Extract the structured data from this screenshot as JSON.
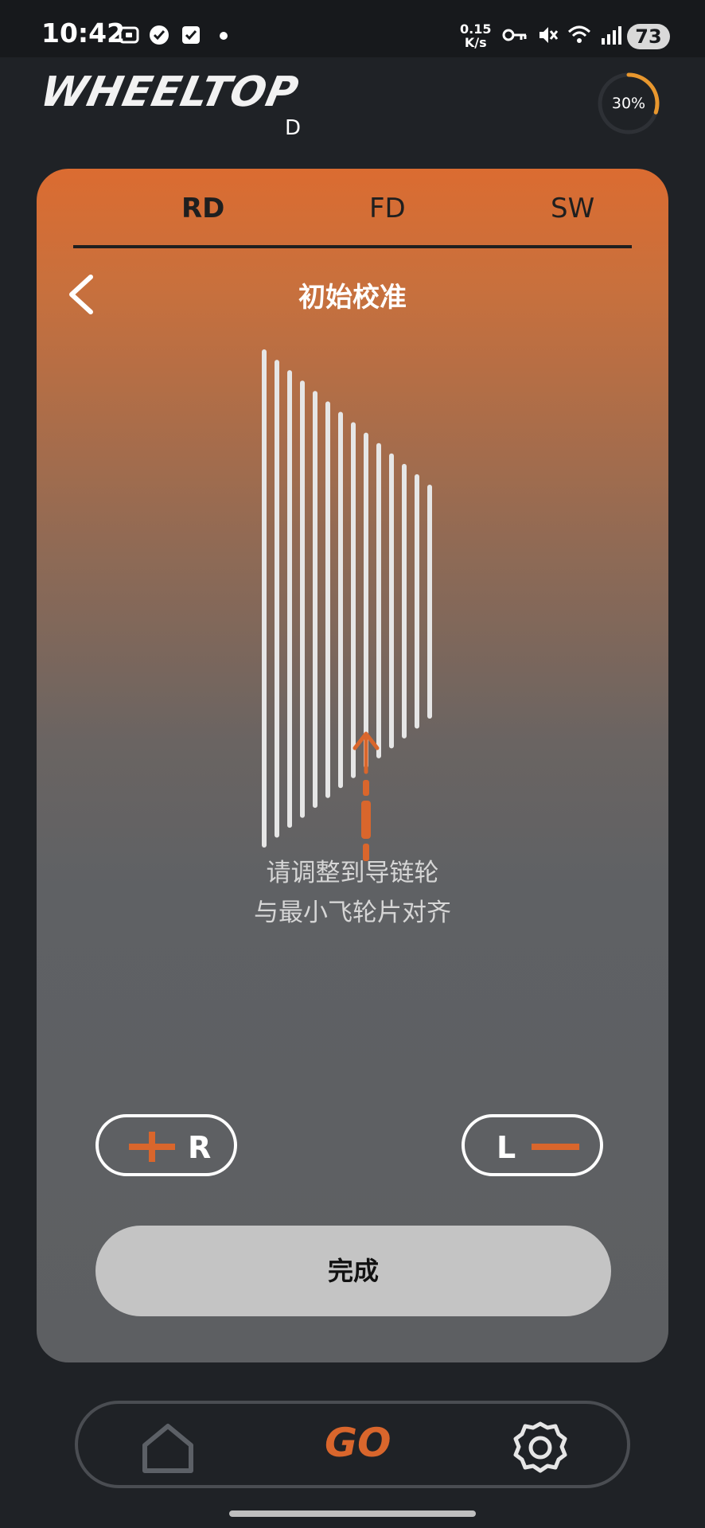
{
  "status_bar": {
    "time": "10:42",
    "net_speed_value": "0.15",
    "net_speed_unit": "K/s",
    "battery": "73"
  },
  "app": {
    "logo": "WHEELTOP",
    "logo_sub": "D",
    "progress": "30%",
    "progress_fraction": 0.3
  },
  "tabs": [
    {
      "label": "RD",
      "active": true
    },
    {
      "label": "FD",
      "active": false
    },
    {
      "label": "SW",
      "active": false
    }
  ],
  "page": {
    "title": "初始校准",
    "instruction_line1": "请调整到导链轮",
    "instruction_line2": "与最小飞轮片对齐"
  },
  "controls": {
    "plus_letter": "R",
    "minus_letter": "L",
    "done_label": "完成"
  },
  "nav": {
    "go_label": "GO"
  },
  "colors": {
    "accent": "#d9662c",
    "card_top": "#db6c31",
    "card_bottom": "#5d5f62",
    "button_bg": "#c4c4c4",
    "background": "#1f2226"
  },
  "icons": {
    "back": "chevron-left-icon",
    "home": "home-icon",
    "settings": "gear-icon",
    "plus": "plus-icon",
    "minus": "minus-icon",
    "arrow": "arrow-up-icon"
  }
}
